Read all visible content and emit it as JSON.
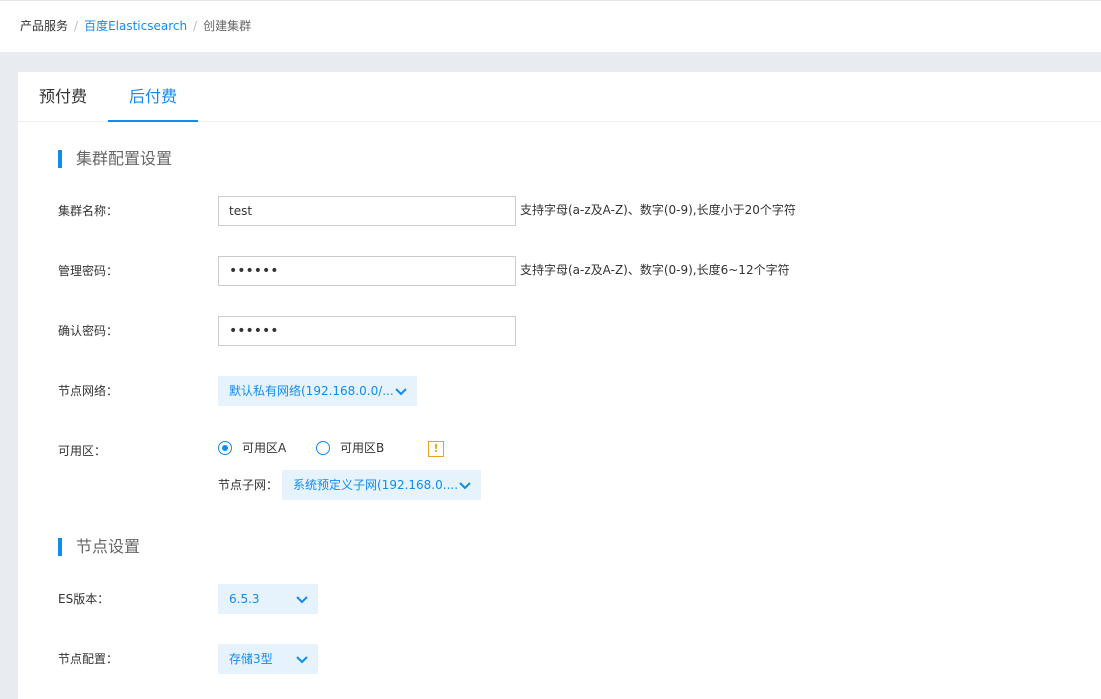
{
  "breadcrumb": {
    "root": "产品服务",
    "link": "百度Elasticsearch",
    "current": "创建集群",
    "separator": "/"
  },
  "tabs": [
    {
      "label": "预付费",
      "active": false
    },
    {
      "label": "后付费",
      "active": true
    }
  ],
  "cluster_section": {
    "title": "集群配置设置",
    "name": {
      "label": "集群名称：",
      "value": "test",
      "hint": "支持字母(a-z及A-Z)、数字(0-9),长度小于20个字符"
    },
    "password": {
      "label": "管理密码：",
      "value": "••••••",
      "hint": "支持字母(a-z及A-Z)、数字(0-9),长度6~12个字符"
    },
    "confirm": {
      "label": "确认密码：",
      "value": "••••••"
    },
    "network": {
      "label": "节点网络：",
      "value": "默认私有网络(192.168.0.0/..."
    },
    "zone": {
      "label": "可用区：",
      "options": [
        {
          "label": "可用区A",
          "checked": true
        },
        {
          "label": "可用区B",
          "checked": false
        }
      ],
      "warn_icon": "!"
    },
    "subnet": {
      "label": "节点子网：",
      "value": "系统预定义子网(192.168.0...."
    }
  },
  "node_section": {
    "title": "节点设置",
    "version": {
      "label": "ES版本：",
      "value": "6.5.3"
    },
    "config": {
      "label": "节点配置：",
      "value": "存储3型"
    }
  },
  "colors": {
    "accent": "#108cee",
    "select_bg": "#e6f3fd",
    "warn": "#f0a020"
  }
}
